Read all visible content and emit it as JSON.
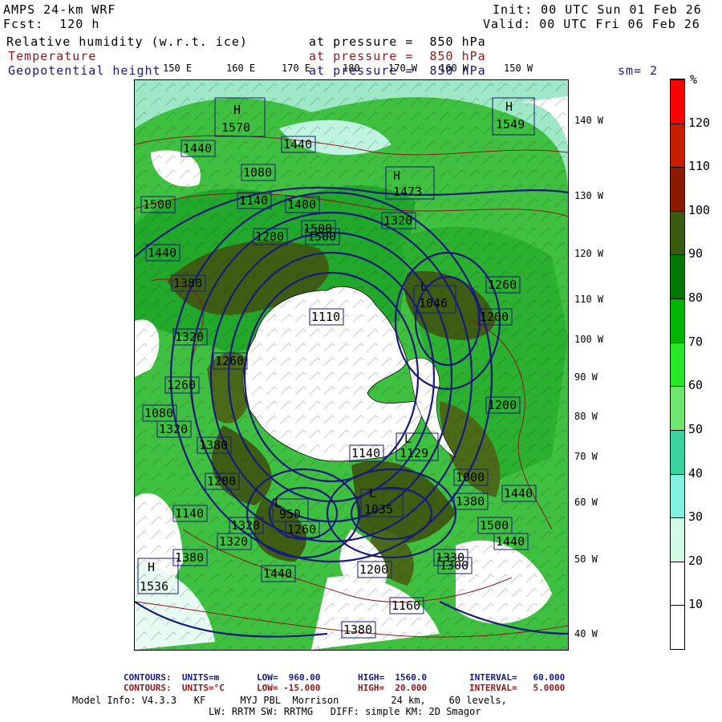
{
  "header": {
    "model": "AMPS 24-km WRF",
    "fcst": "Fcst:  120 h",
    "init": "Init: 00 UTC Sun 01 Feb 26",
    "valid": "Valid: 00 UTC Fri 06 Feb 26"
  },
  "fields": [
    {
      "name": "Relative humidity (w.r.t. ice)",
      "level": "at pressure =  850 hPa",
      "color": "#000000"
    },
    {
      "name": "Temperature",
      "level": "at pressure =  850 hPa",
      "color": "#8b1a1a"
    },
    {
      "name": "Geopotential height",
      "level": "at pressure =  850 hPa",
      "color": "#1a1a7a"
    }
  ],
  "smoothing": "sm= 2",
  "lon_labels": [
    "150 E",
    "160 E",
    "170 E",
    "180",
    "170 W",
    "160 W",
    "150 W"
  ],
  "lat_labels": [
    "140 W",
    "130 W",
    "120 W",
    "110 W",
    "100 W",
    "90 W",
    "80 W",
    "70 W",
    "60 W",
    "50 W",
    "40 W"
  ],
  "colorbar": {
    "unit": "%",
    "ticks": [
      "120",
      "110",
      "100",
      "90",
      "80",
      "70",
      "60",
      "50",
      "40",
      "30",
      "20",
      "10"
    ],
    "colors": [
      "#ff0000",
      "#c81e00",
      "#8b1a00",
      "#3a5a10",
      "#007800",
      "#00b400",
      "#28e628",
      "#6ee66e",
      "#3cd2a0",
      "#82f0dc",
      "#d2fae6",
      "#ffffff",
      "#ffffff"
    ]
  },
  "map_labels": {
    "highs": [
      {
        "t": "H",
        "v": "1570"
      },
      {
        "t": "H",
        "v": "1549"
      },
      {
        "t": "H",
        "v": "1473"
      },
      {
        "t": "H",
        "v": "1536"
      }
    ],
    "lows": [
      {
        "t": "L",
        "v": "1046"
      },
      {
        "t": "L",
        "v": "950"
      },
      {
        "t": "L",
        "v": "1035"
      },
      {
        "t": "L",
        "v": "1129"
      }
    ],
    "contour_values": [
      "1500",
      "1440",
      "1380",
      "1320",
      "1260",
      "1200",
      "1140",
      "1080",
      "1400",
      "1500",
      "1440",
      "1380",
      "1320",
      "1260",
      "1200",
      "1140",
      "1080",
      "1320",
      "1380",
      "1440",
      "1500",
      "1320",
      "1260",
      "1200",
      "1440",
      "1380",
      "1500",
      "1440",
      "1320",
      "1260",
      "1140",
      "1110",
      "1200",
      "1300",
      "1000",
      "1200",
      "1160",
      "1330",
      "1380",
      "1440"
    ]
  },
  "footer": {
    "line1_label": "CONTOURS:  UNITS=m",
    "line1_low": "LOW=  960.00",
    "line1_high": "HIGH=  1560.0",
    "line1_int": "INTERVAL=   60.000",
    "line2_label": "CONTOURS:  UNITS=°C",
    "line2_low": "LOW= -15.000",
    "line2_high": "HIGH=  20.000",
    "line2_int": "INTERVAL=   5.0000",
    "line3": "Model Info: V4.3.3   KF      MYJ PBL  Morrison         24 km,    60 levels,",
    "line4": "LW: RRTM SW: RRTMG   DIFF: simple KM: 2D Smagor"
  }
}
